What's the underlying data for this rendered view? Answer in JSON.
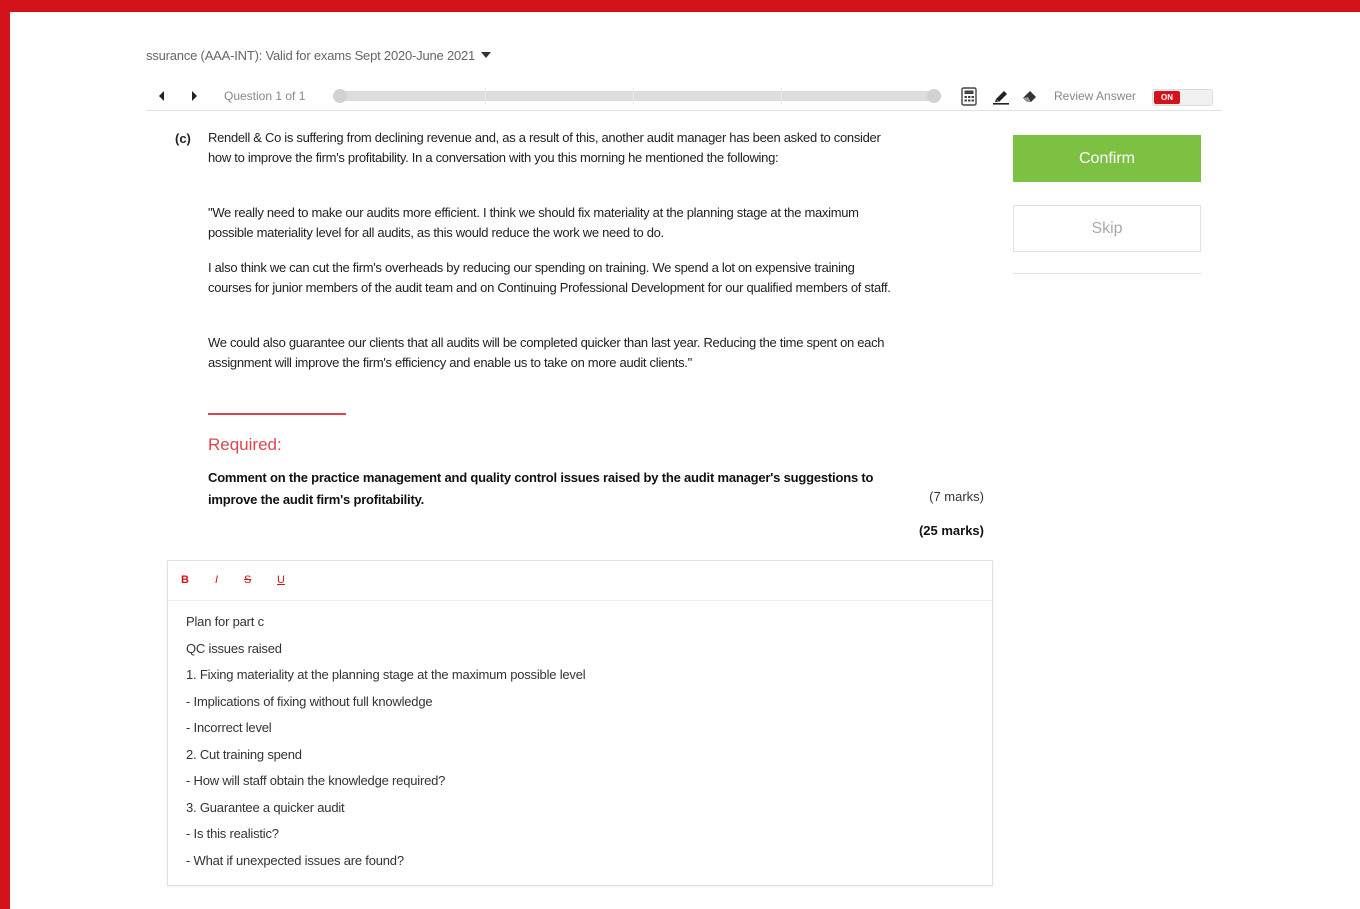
{
  "header": {
    "exam_title": "ssurance (AAA-INT): Valid for exams Sept 2020-June 2021"
  },
  "toolbar": {
    "question_counter": "Question 1 of 1",
    "review_answer_label": "Review Answer",
    "review_toggle_state": "ON",
    "icons": [
      "chevron-left-icon",
      "chevron-right-icon",
      "calculator-icon",
      "highlighter-icon",
      "eraser-icon"
    ]
  },
  "question": {
    "part_label": "(c)",
    "paragraphs": [
      "Rendell & Co is suffering from declining revenue and, as a result of this, another audit manager has been asked to consider how to improve the firm's profitability. In a conversation with you this morning he mentioned the following:",
      "\"We really need to make our audits more efficient. I think we should fix materiality at the planning stage at the maximum possible materiality level for all audits, as this would reduce the work we need to do.",
      "I also think we can cut the firm's overheads by reducing our spending on training. We spend a lot on expensive training courses for junior members of the audit team and on Continuing Professional Development for our qualified members of staff.",
      "We could also guarantee our clients that all audits will be completed quicker than last year. Reducing the time spent on each assignment will improve the firm's efficiency and enable us to take on more audit clients.\""
    ],
    "required_title": "Required:",
    "required_text": "Comment on the practice management and quality control issues raised by the audit manager's suggestions to improve the audit firm's profitability.",
    "part_marks": "(7 marks)",
    "total_marks": "(25 marks)"
  },
  "editor": {
    "format_buttons": {
      "bold": "B",
      "italic": "I",
      "strike": "S",
      "underline": "U"
    },
    "lines": [
      "Plan for part c",
      "QC issues raised",
      "1. Fixing materiality at the planning stage at the maximum possible level",
      " - Implications of fixing without full knowledge",
      " - Incorrect level",
      "2. Cut training spend",
      " - How will staff obtain the knowledge required?",
      "3. Guarantee a quicker audit",
      "- Is this realistic?",
      "- What if unexpected issues are found?"
    ]
  },
  "sidebar": {
    "confirm_label": "Confirm",
    "skip_label": "Skip"
  },
  "colors": {
    "frame_red": "#d3121a",
    "confirm_green": "#7dc143",
    "required_red": "#e0454d"
  }
}
